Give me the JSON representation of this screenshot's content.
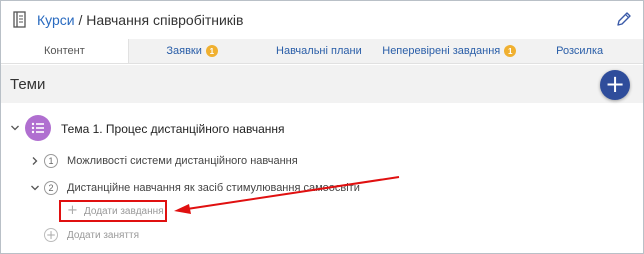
{
  "header": {
    "breadcrumb_link": "Курси",
    "separator": " / ",
    "title": "Навчання співробітників"
  },
  "tabs": [
    {
      "label": "Контент",
      "active": true,
      "badge": ""
    },
    {
      "label": "Заявки",
      "active": false,
      "badge": "1"
    },
    {
      "label": "Навчальні плани",
      "active": false,
      "badge": ""
    },
    {
      "label": "Неперевірені завдання",
      "active": false,
      "badge": "1"
    },
    {
      "label": "Розсилка",
      "active": false,
      "badge": ""
    }
  ],
  "themes": {
    "title": "Теми",
    "add_symbol": "+"
  },
  "topic": {
    "title": "Тема 1. Процес дистанційного навчання",
    "lessons": [
      {
        "number": "1",
        "title": "Можливості системи дистанційного навчання",
        "expanded": false
      },
      {
        "number": "2",
        "title": "Дистанційне навчання як засіб стимулювання самоосвіти",
        "expanded": true
      }
    ],
    "add_task": "Додати завдання",
    "add_lesson": "Додати заняття"
  },
  "colors": {
    "link": "#2a6bc0",
    "tab_text": "#2a5ea8",
    "badge": "#f0b030",
    "fab": "#2f4d9b",
    "topic_icon": "#b06fd0",
    "annotation": "#e01010"
  },
  "icons": {
    "course": "course-book-icon",
    "edit": "pencil-icon",
    "topic": "list-icon"
  }
}
